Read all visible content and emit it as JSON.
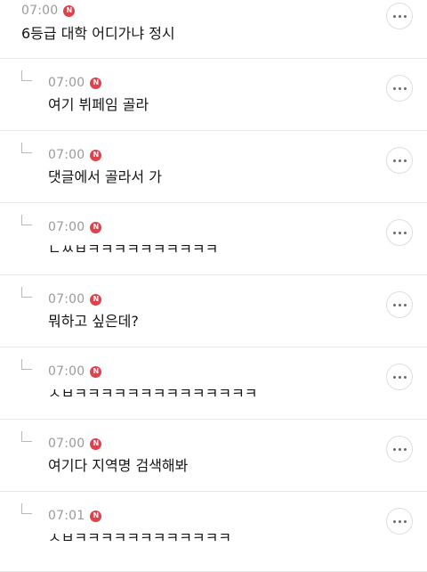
{
  "comments": [
    {
      "time": "07:00",
      "badge": "N",
      "text": "6등급 대학 어디가냐 정시"
    },
    {
      "time": "07:00",
      "badge": "N",
      "text": "여기 뷔페임 골라"
    },
    {
      "time": "07:00",
      "badge": "N",
      "text": "댓글에서 골라서 가"
    },
    {
      "time": "07:00",
      "badge": "N",
      "text": "ㄴㅆㅂㅋㅋㅋㅋㅋㅋㅋㅋㅋㅋ"
    },
    {
      "time": "07:00",
      "badge": "N",
      "text": "뭐하고 싶은데?"
    },
    {
      "time": "07:00",
      "badge": "N",
      "text": "ㅅㅂㅋㅋㅋㅋㅋㅋㅋㅋㅋㅋㅋㅋㅋㅋ"
    },
    {
      "time": "07:00",
      "badge": "N",
      "text": "여기다 지역명 검색해봐"
    },
    {
      "time": "07:01",
      "badge": "N",
      "text": "ㅅㅂㅋㅋㅋㅋㅋㅋㅋㅋㅋㅋㅋㅋ"
    }
  ],
  "colors": {
    "new_badge": "#e0424b",
    "timestamp": "#9a9a9a",
    "divider": "#e6e6e6"
  },
  "icons": {
    "reply": "reply-corner-icon",
    "more": "more-options-icon"
  }
}
